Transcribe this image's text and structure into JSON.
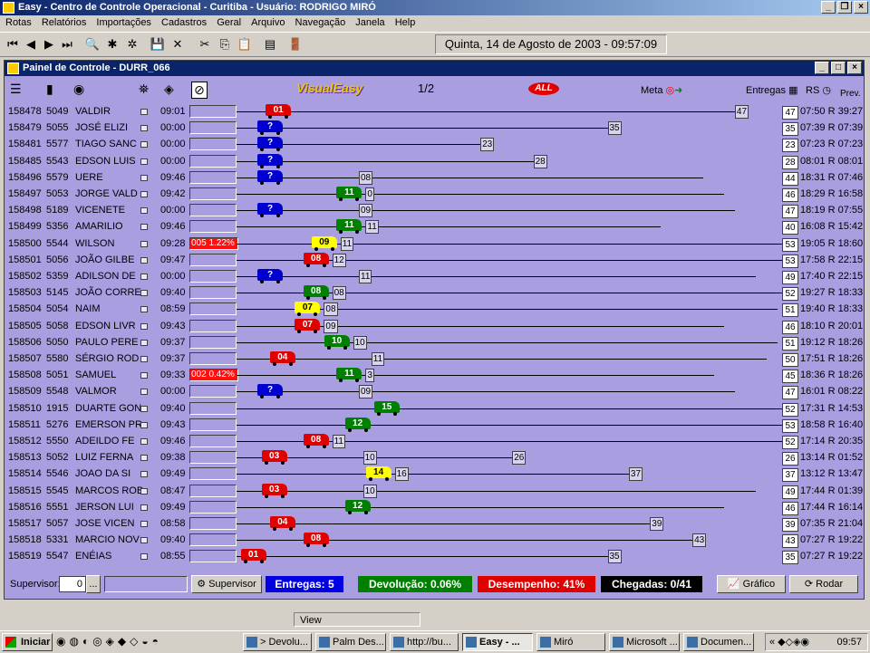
{
  "window": {
    "title": "Easy - Centro de Controle Operacional - Curitiba - Usuário: RODRIGO MIRÓ"
  },
  "menu": [
    "Rotas",
    "Relatórios",
    "Importações",
    "Cadastros",
    "Geral",
    "Arquivo",
    "Navegação",
    "Janela",
    "Help"
  ],
  "toolbar": {
    "date": "Quinta, 14 de Agosto de 2003 - 09:57:09"
  },
  "panel": {
    "title": "Painel de Controle  -  DURR_066",
    "logo": "VisualEasy",
    "pager": "1/2",
    "brand": "ALL",
    "meta_label": "Meta",
    "entregas_label": "Entregas",
    "rs_label": "RS",
    "prev_label": "Prev."
  },
  "colors": {
    "panel_bg": "#a89ee0",
    "red": "#e00000",
    "blue": "#0000d0",
    "green": "#008000",
    "yellow": "#ffff00"
  },
  "rows": [
    {
      "id": "158478",
      "code": "5049",
      "name": "VALDIR",
      "time": "09:01",
      "bar": "",
      "bus_color": "red",
      "bus_label": "01",
      "bus_pos": 0.07,
      "mid": "",
      "end_value": 47,
      "end_label": "47",
      "end_text": "07:50 R 39:27"
    },
    {
      "id": "158479",
      "code": "5055",
      "name": "JOSÉ ELIZI",
      "time": "00:00",
      "bar": "",
      "bus_color": "blue",
      "bus_label": "?",
      "bus_pos": 0.05,
      "mid": "",
      "end_value": 35,
      "end_label": "35",
      "end_text": "07:39 R 07:39"
    },
    {
      "id": "158481",
      "code": "5577",
      "name": "TIAGO SANC",
      "time": "00:00",
      "bar": "",
      "bus_color": "blue",
      "bus_label": "?",
      "bus_pos": 0.05,
      "mid": "",
      "end_value": 23,
      "end_label": "23",
      "end_text": "07:23 R 07:23"
    },
    {
      "id": "158485",
      "code": "5543",
      "name": "EDSON LUIS",
      "time": "00:00",
      "bar": "",
      "bus_color": "blue",
      "bus_label": "?",
      "bus_pos": 0.05,
      "mid": "",
      "end_value": 28,
      "end_label": "28",
      "end_text": "08:01 R 08:01"
    },
    {
      "id": "158496",
      "code": "5579",
      "name": "UERE",
      "time": "09:46",
      "bar": "",
      "bus_color": "blue",
      "bus_label": "?",
      "bus_pos": 0.05,
      "mid": "08",
      "end_value": 44,
      "end_label": "44",
      "end_text": "18:31 R 07:46"
    },
    {
      "id": "158497",
      "code": "5053",
      "name": "JORGE VALD",
      "time": "09:42",
      "bar": "",
      "bus_color": "green",
      "bus_label": "11",
      "bus_pos": 0.24,
      "mid": "0",
      "end_value": 46,
      "end_label": "46",
      "end_text": "18:29 R 16:58"
    },
    {
      "id": "158498",
      "code": "5189",
      "name": "VICENETE",
      "time": "00:00",
      "bar": "",
      "bus_color": "blue",
      "bus_label": "?",
      "bus_pos": 0.05,
      "mid": "09",
      "end_value": 47,
      "end_label": "47",
      "end_text": "18:19 R 07:55"
    },
    {
      "id": "158499",
      "code": "5356",
      "name": "AMARILIO",
      "time": "09:46",
      "bar": "",
      "bus_color": "green",
      "bus_label": "11",
      "bus_pos": 0.24,
      "mid": "11",
      "end_value": 40,
      "end_label": "40",
      "end_text": "16:08 R 15:42"
    },
    {
      "id": "158500",
      "code": "5544",
      "name": "WILSON",
      "time": "09:28",
      "bar": "005 1.22%",
      "bus_color": "yellow",
      "bus_label": "09",
      "bus_pos": 0.18,
      "mid": "11",
      "end_value": 53,
      "end_label": "53",
      "end_text": "19:05 R 18:60"
    },
    {
      "id": "158501",
      "code": "5056",
      "name": "JOÃO GILBE",
      "time": "09:47",
      "bar": "",
      "bus_color": "red",
      "bus_label": "08",
      "bus_pos": 0.16,
      "mid": "12",
      "end_value": 53,
      "end_label": "53",
      "end_text": "17:58 R 22:15"
    },
    {
      "id": "158502",
      "code": "5359",
      "name": "ADILSON DE",
      "time": "00:00",
      "bar": "",
      "bus_color": "blue",
      "bus_label": "?",
      "bus_pos": 0.05,
      "mid": "11",
      "end_value": 49,
      "end_label": "49",
      "end_text": "17:40 R 22:15"
    },
    {
      "id": "158503",
      "code": "5145",
      "name": "JOÃO CORRE",
      "time": "09:40",
      "bar": "",
      "bus_color": "green",
      "bus_label": "08",
      "bus_pos": 0.16,
      "mid": "08",
      "end_value": 52,
      "end_label": "52",
      "end_text": "19:27 R 18:33"
    },
    {
      "id": "158504",
      "code": "5054",
      "name": "NAIM",
      "time": "08:59",
      "bar": "",
      "bus_color": "yellow",
      "bus_label": "07",
      "bus_pos": 0.14,
      "mid": "08",
      "end_value": 51,
      "end_label": "51",
      "end_text": "19:40 R 18:33"
    },
    {
      "id": "158505",
      "code": "5058",
      "name": "EDSON LIVR",
      "time": "09:43",
      "bar": "",
      "bus_color": "red",
      "bus_label": "07",
      "bus_pos": 0.14,
      "mid": "09",
      "end_value": 46,
      "end_label": "46",
      "end_text": "18:10 R 20:01"
    },
    {
      "id": "158506",
      "code": "5050",
      "name": "PAULO PERE",
      "time": "09:37",
      "bar": "",
      "bus_color": "green",
      "bus_label": "10",
      "bus_pos": 0.21,
      "mid": "10",
      "end_value": 51,
      "end_label": "51",
      "end_text": "19:12 R 18:26"
    },
    {
      "id": "158507",
      "code": "5580",
      "name": "SÉRGIO ROD",
      "time": "09:37",
      "bar": "",
      "bus_color": "red",
      "bus_label": "04",
      "bus_pos": 0.08,
      "mid": "11",
      "end_value": 50,
      "end_label": "50",
      "end_text": "17:51 R 18:26"
    },
    {
      "id": "158508",
      "code": "5051",
      "name": "SAMUEL",
      "time": "09:33",
      "bar": "002 0.42%",
      "bus_color": "green",
      "bus_label": "11",
      "bus_pos": 0.24,
      "mid": "3",
      "end_value": 45,
      "end_label": "45",
      "end_text": "18:36 R 18:26"
    },
    {
      "id": "158509",
      "code": "5548",
      "name": "VALMOR",
      "time": "00:00",
      "bar": "",
      "bus_color": "blue",
      "bus_label": "?",
      "bus_pos": 0.05,
      "mid": "09",
      "end_value": 47,
      "end_label": "47",
      "end_text": "16:01 R 08:22"
    },
    {
      "id": "158510",
      "code": "1915",
      "name": "DUARTE GON",
      "time": "09:40",
      "bar": "",
      "bus_color": "green",
      "bus_label": "15",
      "bus_pos": 0.33,
      "mid": "",
      "end_value": 52,
      "end_label": "52",
      "end_text": "17:31 R 14:53"
    },
    {
      "id": "158511",
      "code": "5276",
      "name": "EMERSON PR",
      "time": "09:43",
      "bar": "",
      "bus_color": "green",
      "bus_label": "12",
      "bus_pos": 0.26,
      "mid": "",
      "end_value": 53,
      "end_label": "53",
      "end_text": "18:58 R 16:40"
    },
    {
      "id": "158512",
      "code": "5550",
      "name": "ADEILDO FE",
      "time": "09:46",
      "bar": "",
      "bus_color": "red",
      "bus_label": "08",
      "bus_pos": 0.16,
      "mid": "11",
      "end_value": 52,
      "end_label": "52",
      "end_text": "17:14 R 20:35"
    },
    {
      "id": "158513",
      "code": "5052",
      "name": "LUIZ FERNA",
      "time": "09:38",
      "bar": "",
      "bus_color": "red",
      "bus_label": "03",
      "bus_pos": 0.06,
      "mid": "10",
      "end_value": 26,
      "end_label": "26",
      "end_text": "13:14 R 01:52"
    },
    {
      "id": "158514",
      "code": "5546",
      "name": "JOAO DA SI",
      "time": "09:49",
      "bar": "",
      "bus_color": "yellow",
      "bus_label": "14",
      "bus_pos": 0.31,
      "mid": "16",
      "end_value": 37,
      "end_label": "37",
      "end_text": "13:12 R 13:47"
    },
    {
      "id": "158515",
      "code": "5545",
      "name": "MARCOS ROB",
      "time": "08:47",
      "bar": "",
      "bus_color": "red",
      "bus_label": "03",
      "bus_pos": 0.06,
      "mid": "10",
      "end_value": 49,
      "end_label": "49",
      "end_text": "17:44 R 01:39"
    },
    {
      "id": "158516",
      "code": "5551",
      "name": "JERSON LUI",
      "time": "09:49",
      "bar": "",
      "bus_color": "green",
      "bus_label": "12",
      "bus_pos": 0.26,
      "mid": "",
      "end_value": 46,
      "end_label": "46",
      "end_text": "17:44 R 16:14"
    },
    {
      "id": "158517",
      "code": "5057",
      "name": "JOSE VICEN",
      "time": "08:58",
      "bar": "",
      "bus_color": "red",
      "bus_label": "04",
      "bus_pos": 0.08,
      "mid": "39",
      "end_value": 39,
      "end_label": "39",
      "end_text": "07:35 R 21:04"
    },
    {
      "id": "158518",
      "code": "5331",
      "name": "MARCIO NOV",
      "time": "09:40",
      "bar": "",
      "bus_color": "red",
      "bus_label": "08",
      "bus_pos": 0.16,
      "mid": "43",
      "end_value": 43,
      "end_label": "43",
      "end_text": "07:27 R 19:22"
    },
    {
      "id": "158519",
      "code": "5547",
      "name": "ENÉIAS",
      "time": "08:55",
      "bar": "",
      "bus_color": "red",
      "bus_label": "01",
      "bus_pos": 0.01,
      "mid": "35",
      "end_value": 35,
      "end_label": "35",
      "end_text": "07:27 R 19:22"
    }
  ],
  "status": {
    "supervisor_label": "Supervisor:",
    "supervisor_value": "0",
    "ellipsis": "...",
    "supervisor_button": "Supervisor",
    "entregas": "Entregas: 5",
    "devolucao": "Devolução: 0.06%",
    "desempenho": "Desempenho: 41%",
    "chegadas": "Chegadas: 0/41",
    "grafico_button": "Gráfico",
    "rodar_button": "Rodar"
  },
  "viewbar": {
    "label": "View"
  },
  "taskbar": {
    "start": "Iniciar",
    "tasks": [
      "> Devolu...",
      "Palm Des...",
      "http://bu...",
      "Easy - ...",
      "Miró",
      "Microsoft ...",
      "Documen..."
    ],
    "active_index": 3,
    "clock": "09:57"
  }
}
